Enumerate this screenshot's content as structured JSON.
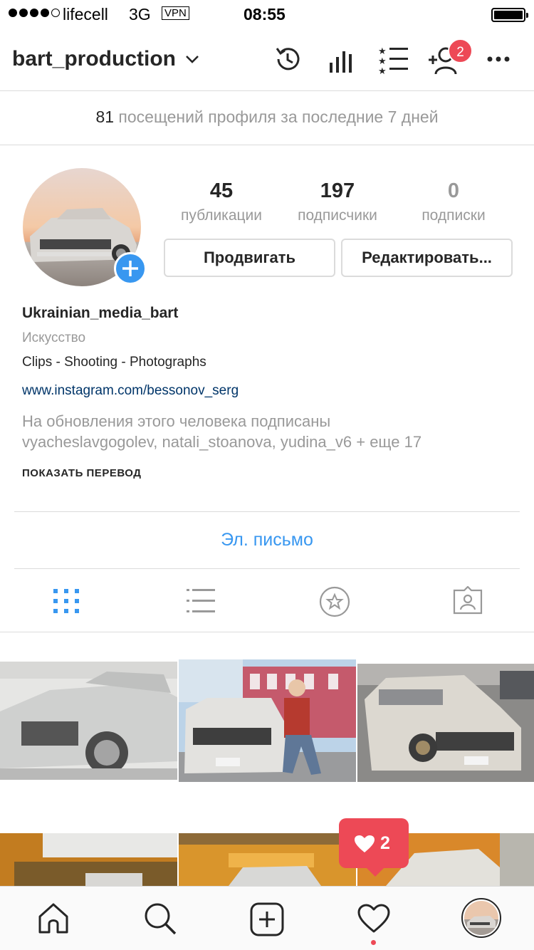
{
  "status_bar": {
    "carrier": "lifecell",
    "network": "3G",
    "vpn": "VPN",
    "time": "08:55"
  },
  "header": {
    "username": "bart_production",
    "notification_badge": "2"
  },
  "visits": {
    "count": "81",
    "text": "посещений профиля за последние 7 дней"
  },
  "stats": [
    {
      "value": "45",
      "label": "публикации"
    },
    {
      "value": "197",
      "label": "подписчики"
    },
    {
      "value": "0",
      "label": "подписки"
    }
  ],
  "buttons": {
    "promote": "Продвигать",
    "edit": "Редактировать..."
  },
  "profile": {
    "name": "Ukrainian_media_bart",
    "category": "Искусство",
    "bio": "Clips - Shooting - Photographs",
    "link": "www.instagram.com/bessonov_serg",
    "followed_line1": "На обновления этого человека подписаны",
    "followed_line2": "vyacheslavgogolev, natali_stoanova, yudina_v6 + еще 17",
    "translate": "ПОКАЗАТЬ ПЕРЕВОД"
  },
  "contact": {
    "email": "Эл. письмо"
  },
  "activity_popup": {
    "likes": "2"
  },
  "colors": {
    "accent": "#3897f0",
    "badge": "#ed4956",
    "text": "#262626",
    "muted": "#999999",
    "border": "#dbdbdb"
  }
}
